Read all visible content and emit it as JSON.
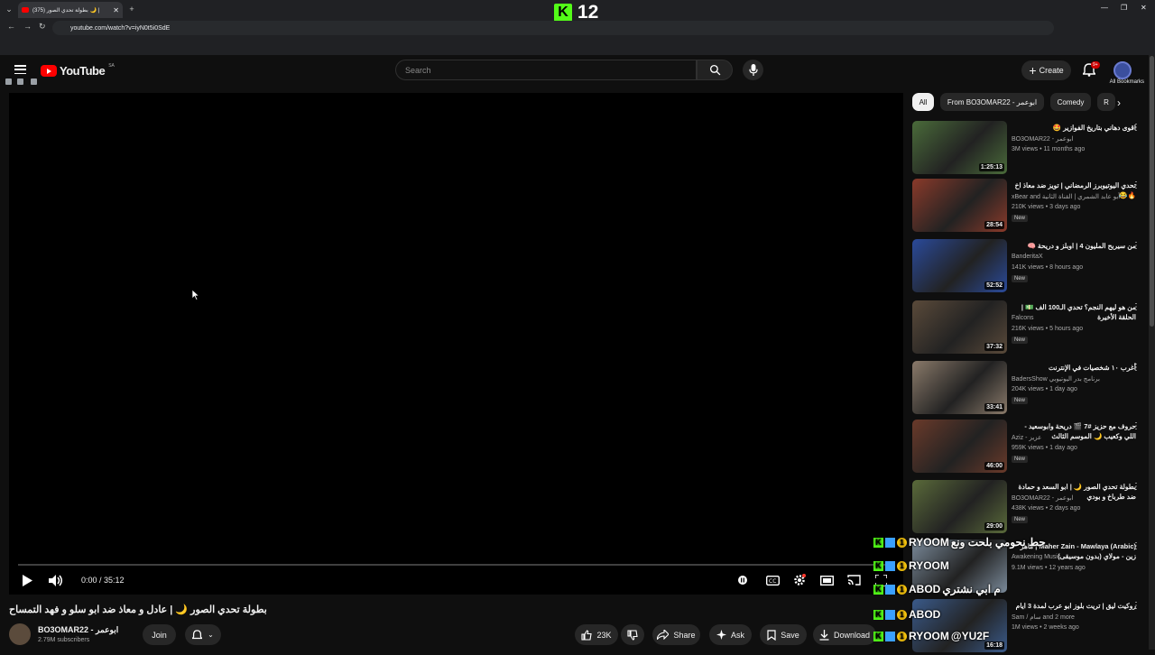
{
  "browser": {
    "tab_title": "(375) بطولة تحدي الصور 🌙 |",
    "url": "youtube.com/watch?v=iyN0t5i0SdE",
    "all_bookmarks": "All Bookmarks",
    "overlay_count": "12"
  },
  "header": {
    "logo_text": "YouTube",
    "country": "SA",
    "search_placeholder": "Search",
    "create_label": "Create",
    "notif_badge": "9+"
  },
  "player": {
    "timecode": "0:00 / 35:12"
  },
  "video": {
    "title": "بطولة تحدي الصور 🌙 | عادل و معاذ ضد ابو سلو و فهد التمساح",
    "channel": "BO3OMAR22 - ابوعمر",
    "subscribers": "2.79M subscribers",
    "join_label": "Join",
    "likes": "23K",
    "share_label": "Share",
    "ask_label": "Ask",
    "save_label": "Save",
    "download_label": "Download"
  },
  "chips": [
    "All",
    "From BO3OMAR22 - ابوعمر",
    "Comedy",
    "R"
  ],
  "recommendations": [
    {
      "title": "اقوى دهاني بتاريخ الفوازير 🤩",
      "channel": "BO3OMAR22 - ابوعمر",
      "views": "3M views • 11 months ago",
      "duration": "1:25:13",
      "new": "",
      "color": "#4a6b3a"
    },
    {
      "title": "تحدي اليوتيوبرز الرمضاني | تويز ضد معاذ اخ 🔥😂",
      "channel": "xBear and أبو عابد الشمري | القناة الثانية",
      "views": "210K views • 3 days ago",
      "duration": "28:54",
      "new": "New",
      "color": "#8a3a2a"
    },
    {
      "title": "من سيربح المليون 4 | اوبلز و دريحة 🧠",
      "channel": "BanderitaX",
      "views": "141K views • 8 hours ago",
      "duration": "52:52",
      "new": "New",
      "color": "#2a4a9a"
    },
    {
      "title": "من هو ليهم النجم؟ تحدي الـ100 الف 💵 | الحلقة الأخيرة",
      "channel": "Falcons",
      "views": "216K views • 5 hours ago",
      "duration": "37:32",
      "new": "New",
      "color": "#5a4a3a"
    },
    {
      "title": "أغرب ١٠ شخصيات في الإنترنت",
      "channel": "BadersShow برنامج بدر اليوتيوبي",
      "views": "204K views • 1 day ago",
      "duration": "33:41",
      "new": "New",
      "color": "#8a7a6a"
    },
    {
      "title": "حروف مع حزيز #7 🎬 دريحة وابوسعيد - اللي وكعيب 🌙 الموسم الثالث",
      "channel": "Aziz - عزيز",
      "views": "959K views • 1 day ago",
      "duration": "46:00",
      "new": "New",
      "color": "#6a3a2a"
    },
    {
      "title": "بطولة تحدي الصور 🌙 | ابو السعد و حمادة ضد طرباخ و بودي",
      "channel": "BO3OMAR22 - ابوعمر",
      "views": "438K views • 2 days ago",
      "duration": "29:00",
      "new": "New",
      "color": "#5a6a3a"
    },
    {
      "title": "Maher Zain - Mawlaya (Arabic) | ماهر زين - مولاي (بدون موسيقى)",
      "channel": "Awakening Music",
      "views": "9.1M views • 12 years ago",
      "duration": "",
      "new": "",
      "color": "#7a8a9a"
    },
    {
      "title": "روكيت ليق | تريت بلوز ابو عرب لمدة 3 ايام",
      "channel": "Sam / سام and 2 more",
      "views": "1M views • 2 weeks ago",
      "duration": "16:18",
      "new": "",
      "color": "#3a5a8a"
    }
  ],
  "chat_overlay": [
    {
      "user": "RYOOM",
      "msg": "حط نحومي بلحت ونع"
    },
    {
      "user": "RYOOM",
      "msg": ""
    },
    {
      "user": "ABOD",
      "msg": "م ابي نشتري"
    },
    {
      "user": "ABOD",
      "msg": ""
    },
    {
      "user": "RYOOM",
      "msg": "@YU2F"
    }
  ]
}
